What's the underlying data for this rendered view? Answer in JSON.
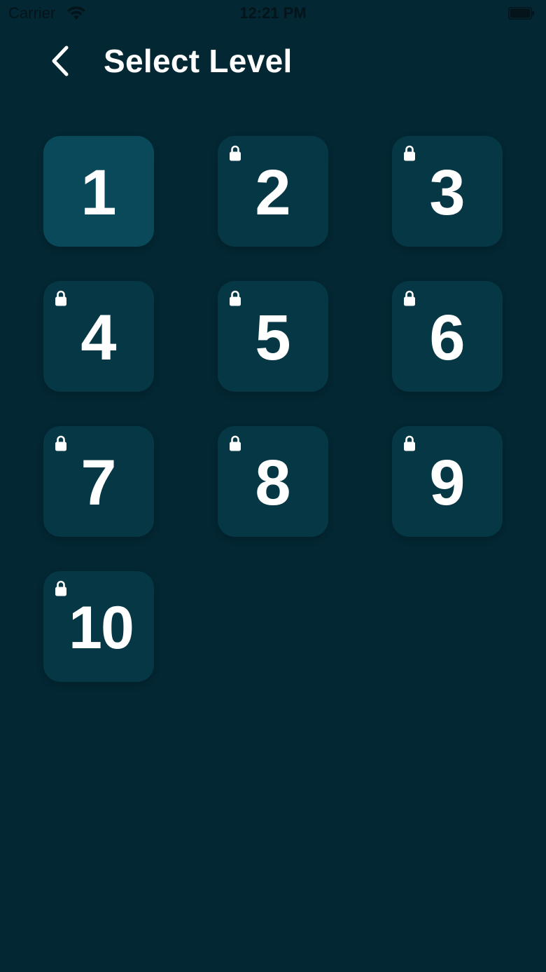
{
  "status_bar": {
    "carrier": "Carrier",
    "time": "12:21 PM"
  },
  "header": {
    "title": "Select Level",
    "back_icon": "chevron-left-icon"
  },
  "colors": {
    "background": "#032733",
    "tile": "#053744",
    "tile_unlocked": "#09495a",
    "text": "#ffffff"
  },
  "levels": [
    {
      "label": "1",
      "locked": false
    },
    {
      "label": "2",
      "locked": true
    },
    {
      "label": "3",
      "locked": true
    },
    {
      "label": "4",
      "locked": true
    },
    {
      "label": "5",
      "locked": true
    },
    {
      "label": "6",
      "locked": true
    },
    {
      "label": "7",
      "locked": true
    },
    {
      "label": "8",
      "locked": true
    },
    {
      "label": "9",
      "locked": true
    },
    {
      "label": "10",
      "locked": true
    }
  ]
}
